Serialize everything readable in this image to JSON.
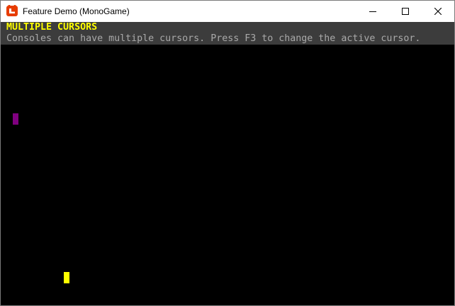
{
  "window": {
    "title": "Feature Demo (MonoGame)",
    "icon": "monogame-logo-icon",
    "controls": [
      "minimize-icon",
      "maximize-icon",
      "close-icon"
    ]
  },
  "console": {
    "title": "MULTIPLE CURSORS",
    "description": "Consoles can have multiple cursors. Press F3 to change the active cursor.",
    "colors": {
      "background": "#000000",
      "header_background": "#3c3c3c",
      "title": "#ffff00",
      "description": "#a9a9a9"
    },
    "cursors": [
      {
        "name": "cursor-1",
        "color": "#800080",
        "active": false
      },
      {
        "name": "cursor-2",
        "color": "#ffff00",
        "active": true
      }
    ]
  },
  "accent": "#e73c00"
}
